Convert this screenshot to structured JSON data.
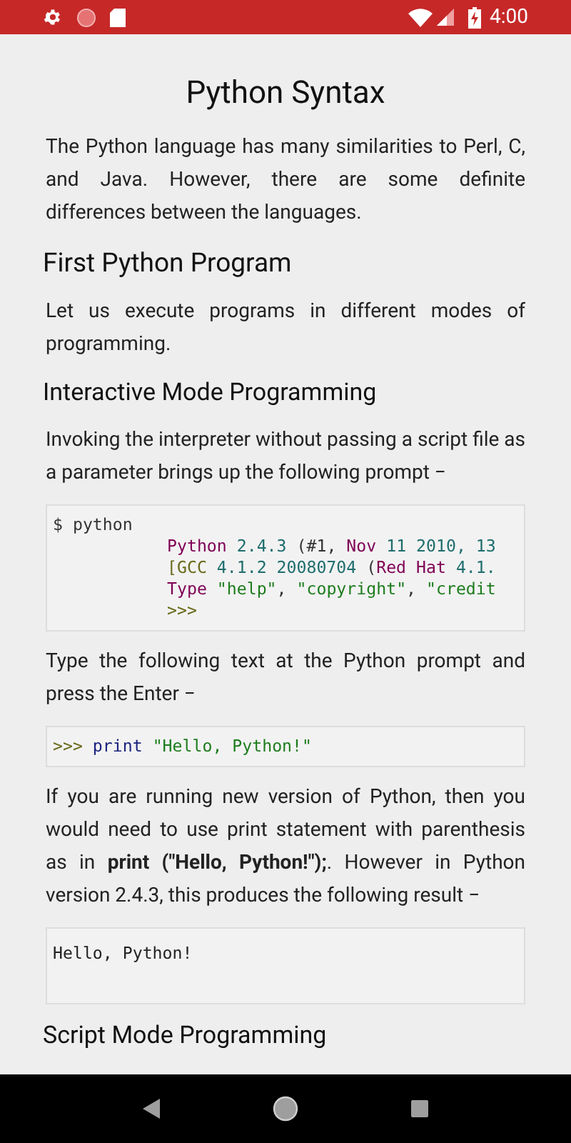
{
  "status_bar": {
    "time": "4:00"
  },
  "article": {
    "title": "Python Syntax",
    "blocks": [
      {
        "kind": "para",
        "text": "The Python language has many similarities to Perl, C, and Java. However, there are some definite differences between the languages."
      },
      {
        "kind": "h2",
        "text": "First Python Program"
      },
      {
        "kind": "para",
        "text": "Let us execute programs in different modes of programming."
      },
      {
        "kind": "h3",
        "text": "Interactive Mode Programming"
      },
      {
        "kind": "para",
        "text": "Invoking the interpreter without passing a script file as a parameter brings up the following prompt −"
      },
      {
        "kind": "code",
        "lines": [
          {
            "indented": false,
            "tokens": [
              {
                "kind": "plain",
                "text": "$ python"
              }
            ]
          },
          {
            "indented": true,
            "tokens": [
              {
                "kind": "keyword",
                "text": "Python"
              },
              {
                "kind": "number",
                "text": " 2.4.3 "
              },
              {
                "kind": "plain",
                "text": "(#1, "
              },
              {
                "kind": "keyword",
                "text": "Nov"
              },
              {
                "kind": "number",
                "text": " 11 2010, 13"
              }
            ]
          },
          {
            "indented": true,
            "tokens": [
              {
                "kind": "prompt",
                "text": "[GCC "
              },
              {
                "kind": "number",
                "text": "4.1.2 20080704 "
              },
              {
                "kind": "plain",
                "text": "("
              },
              {
                "kind": "keyword",
                "text": "Red Hat"
              },
              {
                "kind": "number",
                "text": " 4.1."
              }
            ]
          },
          {
            "indented": true,
            "tokens": [
              {
                "kind": "keyword",
                "text": "Type"
              },
              {
                "kind": "string",
                "text": " \"help\""
              },
              {
                "kind": "plain",
                "text": ", "
              },
              {
                "kind": "string",
                "text": "\"copyright\""
              },
              {
                "kind": "plain",
                "text": ", "
              },
              {
                "kind": "string",
                "text": "\"credit"
              }
            ]
          },
          {
            "indented": true,
            "tokens": [
              {
                "kind": "prompt",
                "text": ">>>"
              }
            ]
          }
        ]
      },
      {
        "kind": "para",
        "text": "Type the following text at the Python prompt and press the Enter −"
      },
      {
        "kind": "code",
        "lines": [
          {
            "indented": false,
            "tokens": [
              {
                "kind": "prompt",
                "text": ">>> "
              },
              {
                "kind": "builtin",
                "text": "print "
              },
              {
                "kind": "string",
                "text": "\"Hello, Python!\""
              }
            ]
          }
        ]
      },
      {
        "kind": "para",
        "text": "If you are running new version of Python, then you would need to use print statement with parenthesis as in **print (\"Hello, Python!\");**. However in Python version 2.4.3, this produces the following result −"
      },
      {
        "kind": "output",
        "lines": [
          "Hello, Python!"
        ]
      },
      {
        "kind": "h3",
        "text": "Script Mode Programming"
      }
    ]
  }
}
